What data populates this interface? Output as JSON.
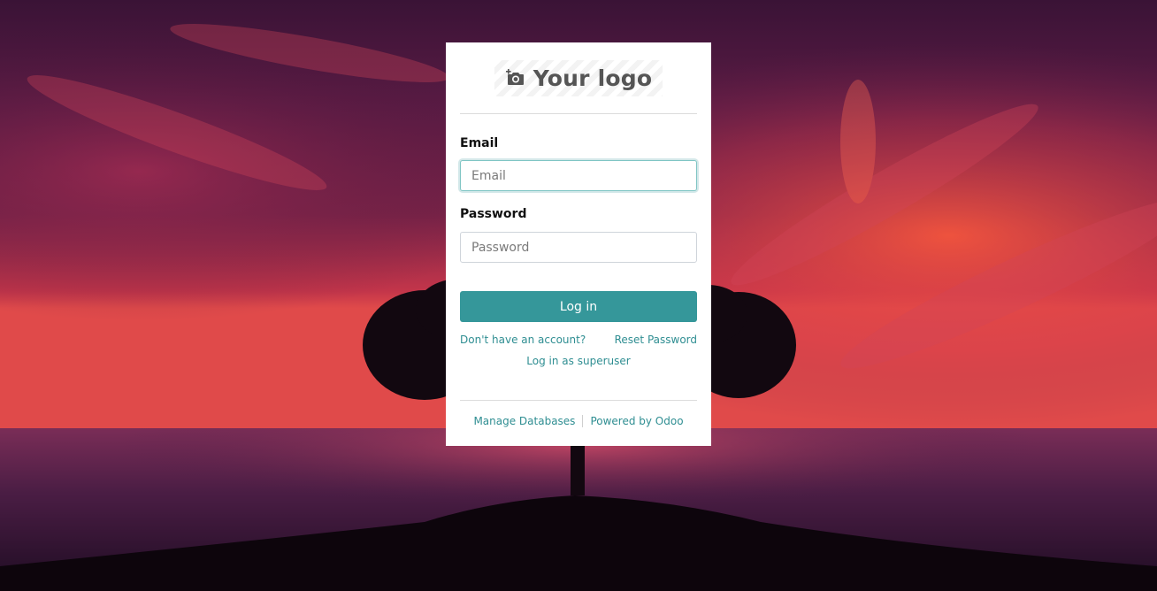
{
  "logo": {
    "text": "Your logo",
    "icon": "camera-plus-icon"
  },
  "form": {
    "email_label": "Email",
    "email_placeholder": "Email",
    "email_value": "",
    "password_label": "Password",
    "password_placeholder": "Password",
    "password_value": "",
    "login_label": "Log in"
  },
  "links": {
    "signup": "Don't have an account?",
    "reset": "Reset Password",
    "superuser": "Log in as superuser"
  },
  "footer": {
    "manage_databases": "Manage Databases",
    "powered_by": "Powered by Odoo"
  },
  "colors": {
    "accent": "#35979a",
    "link": "#2f8e92"
  }
}
